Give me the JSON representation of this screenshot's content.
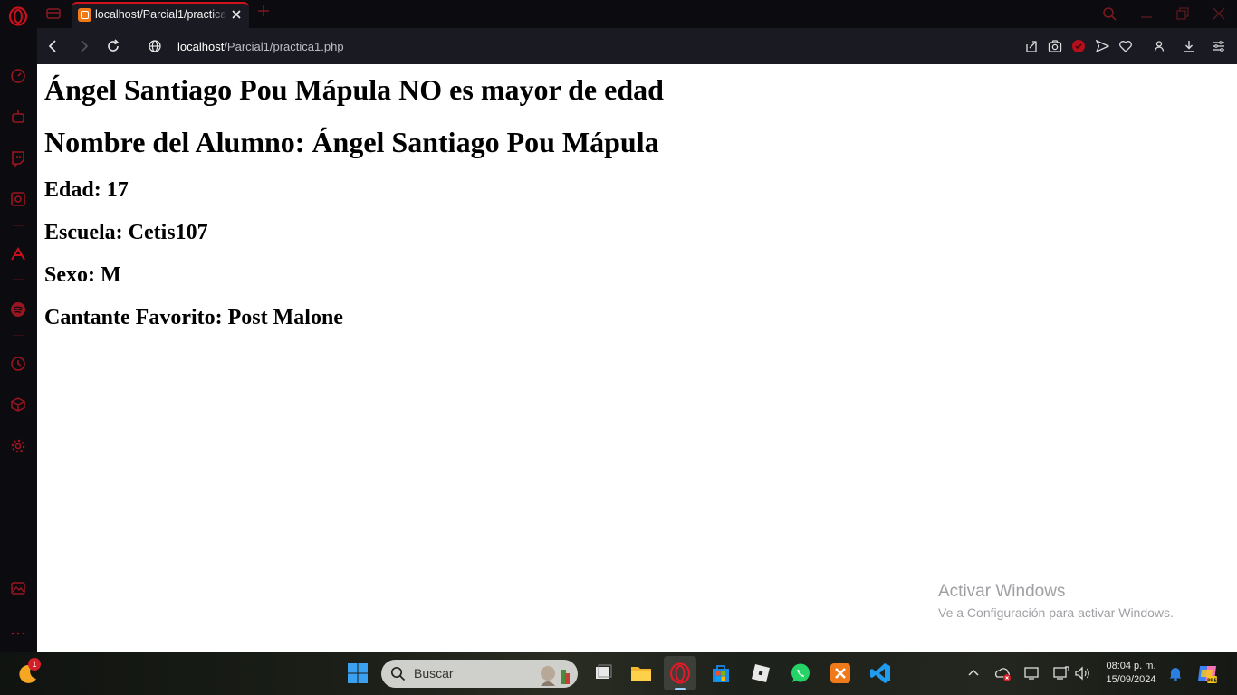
{
  "browser": {
    "tab_title": "localhost/Parcial1/practica1.php",
    "url_host": "localhost",
    "url_path": "/Parcial1/practica1.php",
    "accent_color": "#d0121f"
  },
  "page": {
    "heading": "Ángel Santiago Pou Mápula NO es mayor de edad",
    "student_name": "Nombre del Alumno: Ángel Santiago Pou Mápula",
    "age": "Edad: 17",
    "school": "Escuela: Cetis107",
    "sex": "Sexo: M",
    "singer": "Cantante Favorito: Post Malone"
  },
  "watermark": {
    "title": "Activar Windows",
    "subtitle": "Ve a Configuración para activar Windows."
  },
  "taskbar": {
    "search_placeholder": "Buscar",
    "weather_badge": "1",
    "time": "08:04 p. m.",
    "date": "15/09/2024"
  }
}
